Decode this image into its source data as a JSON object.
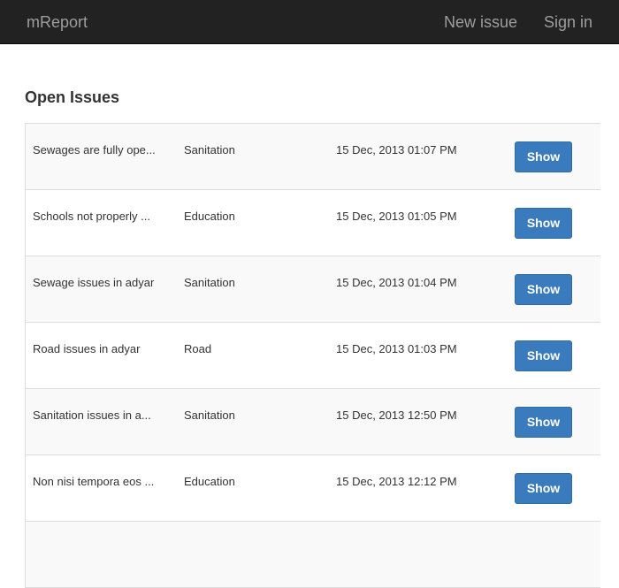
{
  "navbar": {
    "brand": "mReport",
    "new_issue": "New issue",
    "sign_in": "Sign in"
  },
  "page": {
    "title": "Open Issues"
  },
  "issues": [
    {
      "title": "Sewages are fully ope...",
      "category": "Sanitation",
      "date": "15 Dec, 2013 01:07 PM",
      "action": "Show"
    },
    {
      "title": "Schools not properly ...",
      "category": "Education",
      "date": "15 Dec, 2013 01:05 PM",
      "action": "Show"
    },
    {
      "title": "Sewage issues in adyar",
      "category": "Sanitation",
      "date": "15 Dec, 2013 01:04 PM",
      "action": "Show"
    },
    {
      "title": "Road issues in adyar",
      "category": "Road",
      "date": "15 Dec, 2013 01:03 PM",
      "action": "Show"
    },
    {
      "title": "Sanitation issues in a...",
      "category": "Sanitation",
      "date": "15 Dec, 2013 12:50 PM",
      "action": "Show"
    },
    {
      "title": "Non nisi tempora eos ...",
      "category": "Education",
      "date": "15 Dec, 2013 12:12 PM",
      "action": "Show"
    }
  ],
  "colors": {
    "navbar_bg": "#222222",
    "nav_text": "#9d9d9d",
    "button_bg": "#3a7bbd",
    "row_stripe": "#f9f9f9"
  }
}
